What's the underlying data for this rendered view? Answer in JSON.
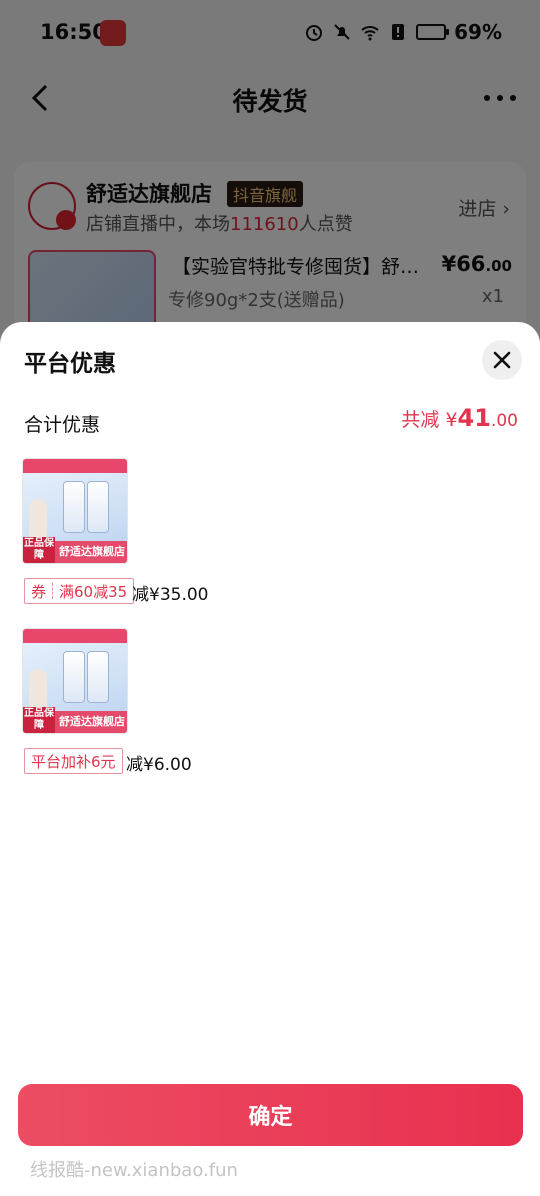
{
  "status_bar": {
    "time": "16:50",
    "battery": "69%"
  },
  "nav": {
    "title": "待发货"
  },
  "order": {
    "shop_name": "舒适达旗舰店",
    "shop_tag": "抖音旗舰",
    "live_prefix": "店铺直播中，本场",
    "live_count": "111610",
    "live_suffix": "人点赞",
    "enter_shop": "进店 ›",
    "product_title": "【实验官特批专修囤货】舒适达专修",
    "product_spec": "专修90g*2支(送赠品)",
    "price_main": "¥66",
    "price_decimal": ".00",
    "quantity": "x1"
  },
  "sheet": {
    "title": "平台优惠",
    "total_label": "合计优惠",
    "total_prefix": "共减 ¥",
    "total_int": "41",
    "total_dec": ".00",
    "items": [
      {
        "thumb_badge": "正品保障",
        "thumb_shop": "舒适达旗舰店",
        "tag_kind": "券",
        "tag_text": "满60减35",
        "reduce": "减¥35.00"
      },
      {
        "thumb_badge": "正品保障",
        "thumb_shop": "舒适达旗舰店",
        "tag_text": "平台加补6元",
        "reduce": "减¥6.00"
      }
    ],
    "confirm_label": "确定"
  },
  "watermark": "线报酷-new.xianbao.fun",
  "colors": {
    "accent": "#e2354d",
    "button": "#ea3d59"
  }
}
